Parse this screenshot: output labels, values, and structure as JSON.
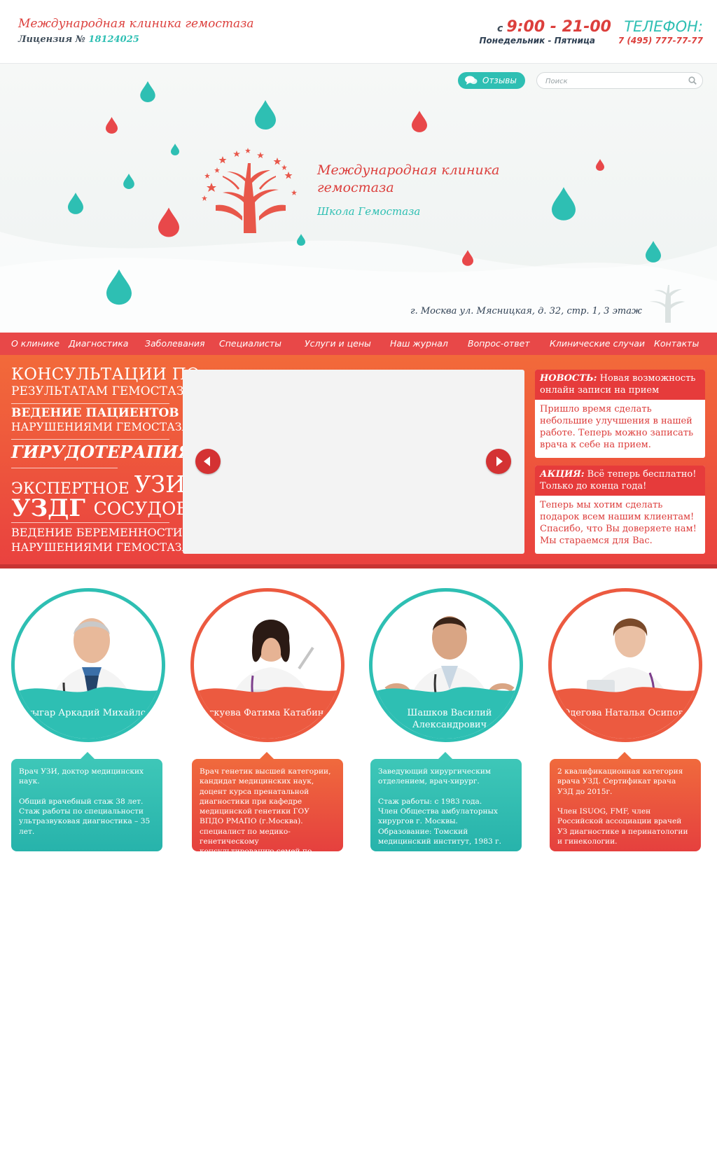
{
  "header": {
    "site_title": "Международная клиника гемостаза",
    "license_label": "Лицензия №",
    "license_number": "18124025",
    "hours_prefix": "с",
    "hours_time": "9:00 - 21-00",
    "days": "Понедельник - Пятница",
    "phone_title": "ТЕЛЕФОН:",
    "phone_number": "7 (495) 777-77-77"
  },
  "hero": {
    "reviews_label": "Отзывы",
    "search_placeholder": "Поиск",
    "logo_title": "Международная клиника гемостаза",
    "logo_subtitle": "Школа Гемостаза",
    "address": "г. Москва ул. Мясницкая, д. 32, стр. 1, 3 этаж"
  },
  "nav": {
    "items": [
      {
        "label": "О клинике"
      },
      {
        "label": "Диагностика"
      },
      {
        "label": "Заболевания"
      },
      {
        "label": "Специалисты"
      },
      {
        "label": "Услуги и цены"
      },
      {
        "label": "Наш журнал"
      },
      {
        "label": "Вопрос-ответ"
      },
      {
        "label": "Клинические случаи"
      },
      {
        "label": "Контакты"
      }
    ]
  },
  "services": {
    "s1a": "Консультации по",
    "s1b": "результатам гемостаза",
    "s2a": "Ведение пациентов с",
    "s2b": "нарушениями гемостаза",
    "s3": "Гирудотерапия",
    "s4a": "Экспертное",
    "s4b": "УЗИ",
    "s5a": "УЗДГ",
    "s5b": "сосудов",
    "s6a": "Ведение беременности с",
    "s6b": "нарушениями гемостаза"
  },
  "news": [
    {
      "head_label": "НОВОСТЬ:",
      "head_text": "Новая возможность онлайн записи на прием",
      "body": "Пришло время сделать небольшие улучшения в нашей работе. Теперь можно записать врача к себе на прием."
    },
    {
      "head_label": "АКЦИЯ:",
      "head_text": "Всё теперь бесплатно! Только до конца года!",
      "body": "Теперь мы хотим сделать подарок всем нашим клиентам! Спасибо, что Вы доверяете нам! Мы стараемся для Вас."
    }
  ],
  "doctors": [
    {
      "name": "Стыгар Аркадий Михайлович",
      "bio": "Врач УЗИ, доктор медицинских наук.\n\nОбщий врачебный стаж 38 лет. Стаж работы по специальности ультразвуковая диагностика – 35 лет."
    },
    {
      "name": "Лагкуева Фатима Катабиновна",
      "bio": "Врач генетик высшей категории, кандидат медицинских наук, доцент курса пренатальной диагностики при кафедре медицинской генетики ГОУ ВПДО РМАПО (г.Москва). специалист по медико-генетическому консультированию семей по"
    },
    {
      "name": "Шашков Василий Александрович",
      "bio": "Заведующий хирургическим отделением, врач-хирург.\n\nСтаж работы: с 1983 года.\nЧлен Общества амбулаторных хирургов г. Москвы.\nОбразование:  Томский медицинский институт, 1983 г."
    },
    {
      "name": "Одегова Наталья Осиповна",
      "bio": "2 квалификационная категория врача УЗД. Сертификат врача УЗД до 2015г.\n\nЧлен ISUOG, FMF, член Российской ассоциации врачей УЗ диагностике в перинатологии и гинекологии."
    }
  ],
  "colors": {
    "red": "#e84848",
    "teal": "#2ebfb3",
    "orange": "#f26a3a"
  }
}
